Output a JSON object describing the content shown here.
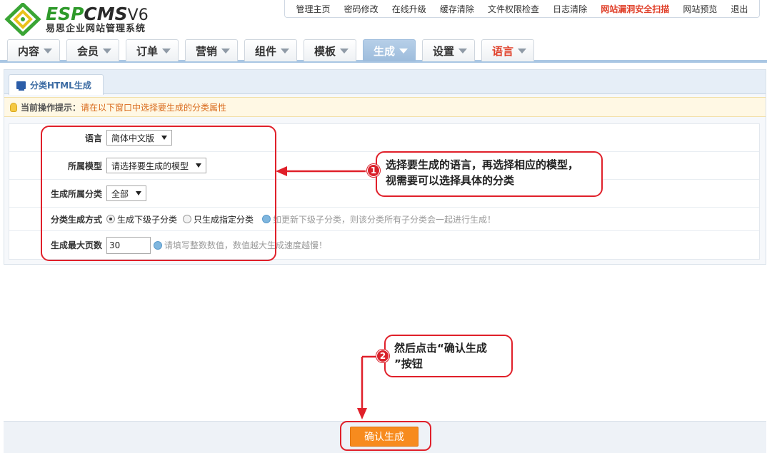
{
  "header": {
    "logo_esp": "ESP",
    "logo_cms": "CMS",
    "logo_version": "V6",
    "logo_subtitle": "易思企业网站管理系统",
    "top_links": [
      "管理主页",
      "密码修改",
      "在线升级",
      "缓存清除",
      "文件权限检查",
      "日志清除",
      "网站漏洞安全扫描",
      "网站预览",
      "退出"
    ]
  },
  "nav": {
    "tabs": [
      "内容",
      "会员",
      "订单",
      "营销",
      "组件",
      "模板",
      "生成",
      "设置",
      "语言"
    ],
    "active": "生成"
  },
  "panel": {
    "subtab_label": "分类HTML生成",
    "tip_label": "当前操作提示：",
    "tip_message": "请在以下窗口中选择要生成的分类属性"
  },
  "form": {
    "language_label": "语言",
    "language_value": "简体中文版",
    "model_label": "所属模型",
    "model_value": "请选择要生成的模型",
    "category_label": "生成所属分类",
    "category_value": "全部",
    "mode_label": "分类生成方式",
    "mode_option_1": "生成下级子分类",
    "mode_option_2": "只生成指定分类",
    "mode_hint": "如更新下级子分类，则该分类所有子分类会一起进行生成！",
    "max_pages_label": "生成最大页数",
    "max_pages_value": "30",
    "max_pages_hint": "请填写整数数值，数值越大生成速度越慢！"
  },
  "confirm_button": "确认生成",
  "annotations": {
    "step1_number": "1",
    "step1_text_line1": "选择要生成的语言，再选择相应的模型，",
    "step1_text_line2": "视需要可以选择具体的分类",
    "step2_number": "2",
    "step2_text_line1": "然后点击“确认生成",
    "step2_text_line2": "”按钮"
  },
  "colors": {
    "brand_green": "#2f9a2b",
    "active_tab": "#9dbcdc",
    "annotation_red": "#e0202a",
    "confirm_orange": "#f78b1e"
  }
}
